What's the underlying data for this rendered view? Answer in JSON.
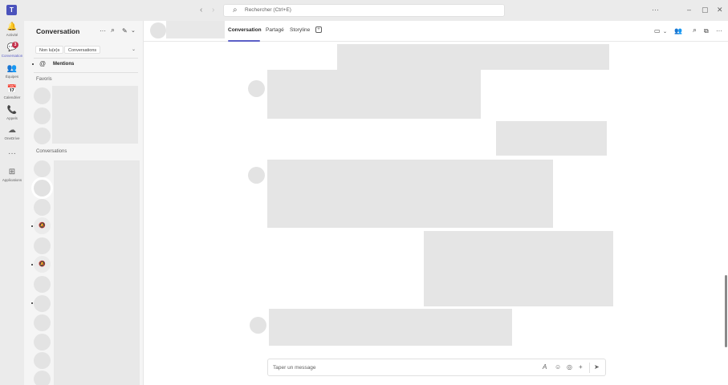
{
  "titlebar": {
    "logo": "T",
    "back_icon": "‹",
    "forward_icon": "›",
    "search_placeholder": "Rechercher (Ctrl+E)",
    "more_icon": "···",
    "minimize_icon": "–",
    "maximize_icon": "▢",
    "close_icon": "✕"
  },
  "rail": {
    "items": [
      {
        "label": "Activité",
        "icon": "🔔"
      },
      {
        "label": "Conversation",
        "icon": "💬",
        "badge": "3"
      },
      {
        "label": "Équipes",
        "icon": "👥"
      },
      {
        "label": "Calendrier",
        "icon": "📅"
      },
      {
        "label": "Appels",
        "icon": "📞"
      },
      {
        "label": "OneDrive",
        "icon": "☁"
      },
      {
        "label": "",
        "icon": "···"
      },
      {
        "label": "Applications",
        "icon": "⊞"
      }
    ],
    "accent_color": "#5b5fc7",
    "badge_color": "#c4314b"
  },
  "list_pane": {
    "title": "Conversation",
    "more_icon": "···",
    "search_icon": "⌕",
    "new_chat_icon": "✎",
    "chevron_icon": "⌄",
    "filters": [
      "Non lu(e)s",
      "Conversations"
    ],
    "filter_chevron": "⌄",
    "mentions_icon": "@",
    "mentions_label": "Mentions",
    "favorites_label": "Favoris",
    "conversations_label": "Conversations",
    "muted_icon": "🔕"
  },
  "chat_header": {
    "tabs": [
      "Conversation",
      "Partagé",
      "Storyline"
    ],
    "active_tab": "Conversation",
    "add_tab_icon": "+",
    "video_icon": "▭",
    "video_chevron": "⌄",
    "people_icon": "👥",
    "search_icon": "⌕",
    "popout_icon": "⧉",
    "more_icon": "···"
  },
  "compose": {
    "placeholder": "Taper un message",
    "format_icon": "A",
    "emoji_icon": "☺",
    "sticker_icon": "◎",
    "attach_icon": "+",
    "send_icon": "➤"
  }
}
